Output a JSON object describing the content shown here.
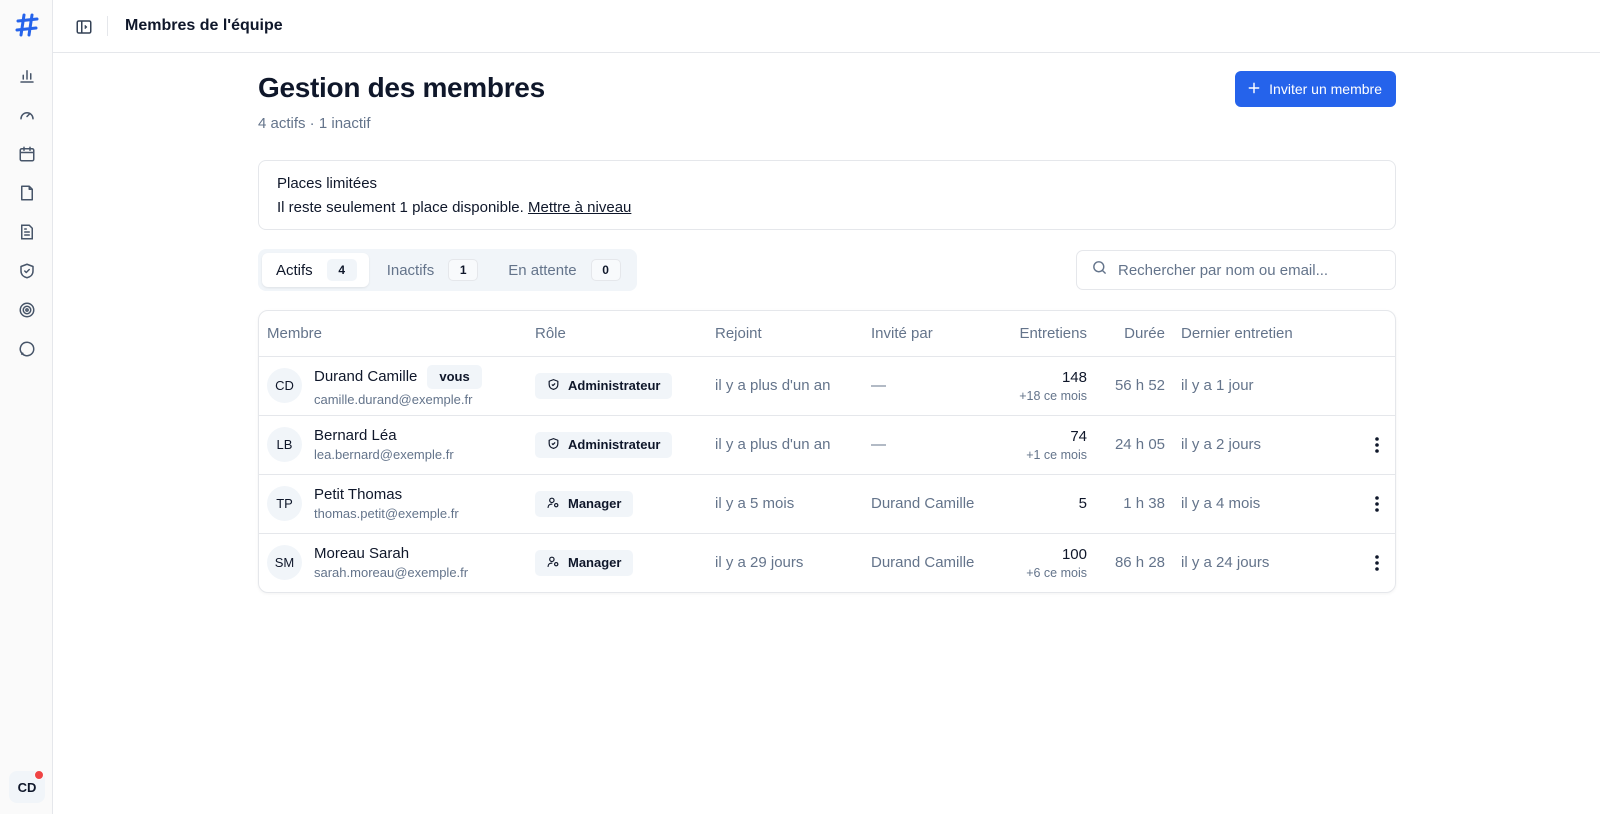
{
  "header": {
    "title": "Membres de l'équipe"
  },
  "sidebar": {
    "icons": [
      "bar-chart-icon",
      "gauge-icon",
      "calendar-icon",
      "file-icon",
      "document-icon",
      "shield-check-icon",
      "target-icon",
      "chat-icon"
    ],
    "user_initials": "CD"
  },
  "page": {
    "title": "Gestion des membres",
    "subtitle": "4 actifs · 1 inactif",
    "invite_label": "Inviter un membre"
  },
  "banner": {
    "title": "Places limitées",
    "text": "Il reste seulement 1 place disponible.",
    "link": "Mettre à niveau"
  },
  "tabs": [
    {
      "label": "Actifs",
      "count": "4",
      "active": true
    },
    {
      "label": "Inactifs",
      "count": "1",
      "active": false
    },
    {
      "label": "En attente",
      "count": "0",
      "active": false
    }
  ],
  "search": {
    "placeholder": "Rechercher par nom ou email..."
  },
  "table": {
    "headers": {
      "member": "Membre",
      "role": "Rôle",
      "joined": "Rejoint",
      "invited_by": "Invité par",
      "interviews": "Entretiens",
      "duration": "Durée",
      "last": "Dernier entretien"
    },
    "rows": [
      {
        "initials": "CD",
        "name": "Durand Camille",
        "you": "vous",
        "email": "camille.durand@exemple.fr",
        "role": "Administrateur",
        "role_icon": "shield-icon",
        "joined": "il y a plus d'un an",
        "invited_by": "—",
        "interviews": "148",
        "interviews_sub": "+18 ce mois",
        "duration": "56 h 52",
        "last": "il y a 1 jour",
        "has_menu": false
      },
      {
        "initials": "LB",
        "name": "Bernard Léa",
        "email": "lea.bernard@exemple.fr",
        "role": "Administrateur",
        "role_icon": "shield-icon",
        "joined": "il y a plus d'un an",
        "invited_by": "—",
        "interviews": "74",
        "interviews_sub": "+1 ce mois",
        "duration": "24 h 05",
        "last": "il y a 2 jours",
        "has_menu": true
      },
      {
        "initials": "TP",
        "name": "Petit Thomas",
        "email": "thomas.petit@exemple.fr",
        "role": "Manager",
        "role_icon": "user-cog-icon",
        "joined": "il y a 5 mois",
        "invited_by": "Durand Camille",
        "interviews": "5",
        "interviews_sub": "",
        "duration": "1 h 38",
        "last": "il y a 4 mois",
        "has_menu": true
      },
      {
        "initials": "SM",
        "name": "Moreau Sarah",
        "email": "sarah.moreau@exemple.fr",
        "role": "Manager",
        "role_icon": "user-cog-icon",
        "joined": "il y a 29 jours",
        "invited_by": "Durand Camille",
        "interviews": "100",
        "interviews_sub": "+6 ce mois",
        "duration": "86 h 28",
        "last": "il y a 24 jours",
        "has_menu": true
      }
    ]
  },
  "colors": {
    "accent": "#2563eb",
    "notification": "#ef4444",
    "muted_text": "#64748b"
  }
}
